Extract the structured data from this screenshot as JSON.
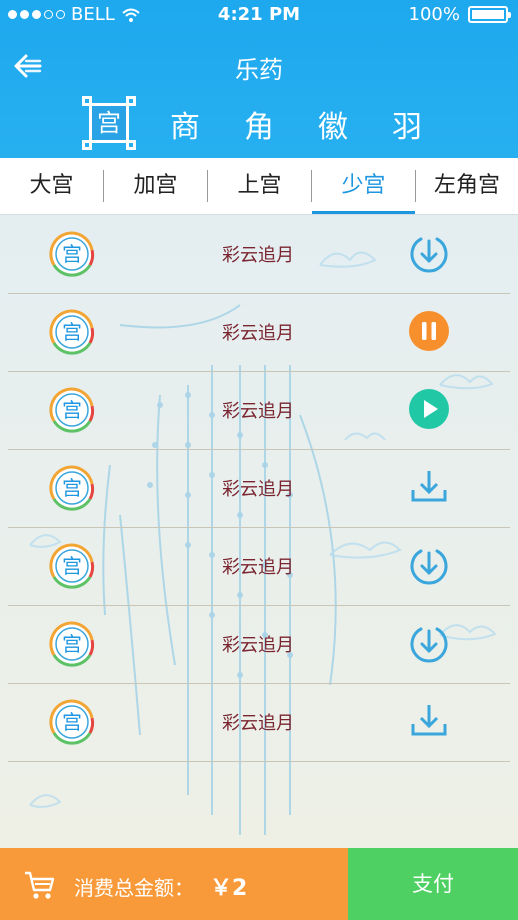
{
  "status_bar": {
    "carrier": "BELL",
    "time": "4:21 PM",
    "battery": "100%",
    "signal_dots_filled": 3,
    "signal_dots_total": 5
  },
  "header": {
    "title": "乐药",
    "badge_char": "宫",
    "tones": [
      "商",
      "角",
      "徽",
      "羽"
    ]
  },
  "tabs": [
    {
      "label": "大宫",
      "active": false
    },
    {
      "label": "加宫",
      "active": false
    },
    {
      "label": "上宫",
      "active": false
    },
    {
      "label": "少宫",
      "active": true
    },
    {
      "label": "左角宫",
      "active": false
    }
  ],
  "tracks": [
    {
      "title": "彩云追月",
      "icon_char": "宫",
      "action": "download-circle-icon"
    },
    {
      "title": "彩云追月",
      "icon_char": "宫",
      "action": "pause-icon"
    },
    {
      "title": "彩云追月",
      "icon_char": "宫",
      "action": "play-icon"
    },
    {
      "title": "彩云追月",
      "icon_char": "宫",
      "action": "download-tray-icon"
    },
    {
      "title": "彩云追月",
      "icon_char": "宫",
      "action": "download-circle-icon"
    },
    {
      "title": "彩云追月",
      "icon_char": "宫",
      "action": "download-circle-icon"
    },
    {
      "title": "彩云追月",
      "icon_char": "宫",
      "action": "download-tray-icon"
    }
  ],
  "footer": {
    "total_label": "消费总金额：",
    "total_value": "￥2",
    "pay_label": "支付"
  },
  "colors": {
    "header_blue": "#1ea8ee",
    "active_tab": "#1e96e0",
    "pause_orange": "#f7902c",
    "play_teal": "#21c8a6",
    "download_blue": "#3aa6dc",
    "footer_orange": "#f99a3a",
    "pay_green": "#4fd063",
    "title_maroon": "#7a2430"
  }
}
